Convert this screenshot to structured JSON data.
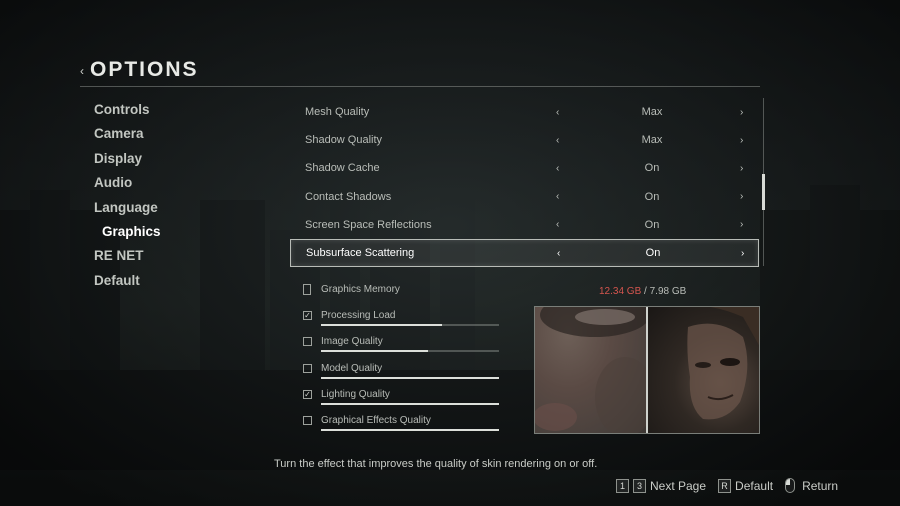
{
  "header": {
    "back_glyph": "‹",
    "title": "OPTIONS"
  },
  "nav": {
    "items": [
      {
        "label": "Controls"
      },
      {
        "label": "Camera"
      },
      {
        "label": "Display"
      },
      {
        "label": "Audio"
      },
      {
        "label": "Language"
      },
      {
        "label": "Graphics",
        "active": true
      },
      {
        "label": "RE NET"
      },
      {
        "label": "Default"
      }
    ]
  },
  "settings": {
    "arrow_left": "‹",
    "arrow_right": "›",
    "rows": [
      {
        "label": "Mesh Quality",
        "value": "Max"
      },
      {
        "label": "Shadow Quality",
        "value": "Max"
      },
      {
        "label": "Shadow Cache",
        "value": "On"
      },
      {
        "label": "Contact Shadows",
        "value": "On"
      },
      {
        "label": "Screen Space Reflections",
        "value": "On"
      },
      {
        "label": "Subsurface Scattering",
        "value": "On",
        "selected": true
      }
    ]
  },
  "impact": {
    "graphics_memory": {
      "label": "Graphics Memory",
      "used": "12.34 GB",
      "separator": "/",
      "total": "7.98 GB",
      "used_color": "#d5554e"
    },
    "items": [
      {
        "label": "Processing Load",
        "checked": true,
        "level": 0.68
      },
      {
        "label": "Image Quality",
        "checked": false,
        "level": 0.6
      },
      {
        "label": "Model Quality",
        "checked": false,
        "level": 1.0
      },
      {
        "label": "Lighting Quality",
        "checked": true,
        "level": 1.0
      },
      {
        "label": "Graphical Effects Quality",
        "checked": false,
        "level": 1.0
      }
    ]
  },
  "description": "Turn the effect that improves the quality of skin rendering on or off.",
  "footer": {
    "key_1": "1",
    "key_3": "3",
    "next_page_label": "Next Page",
    "key_r": "R",
    "default_label": "Default",
    "return_label": "Return"
  },
  "colors": {
    "selected_border": "#b8bcb7",
    "memory_over": "#d5554e",
    "text": "#c8cbc6"
  }
}
